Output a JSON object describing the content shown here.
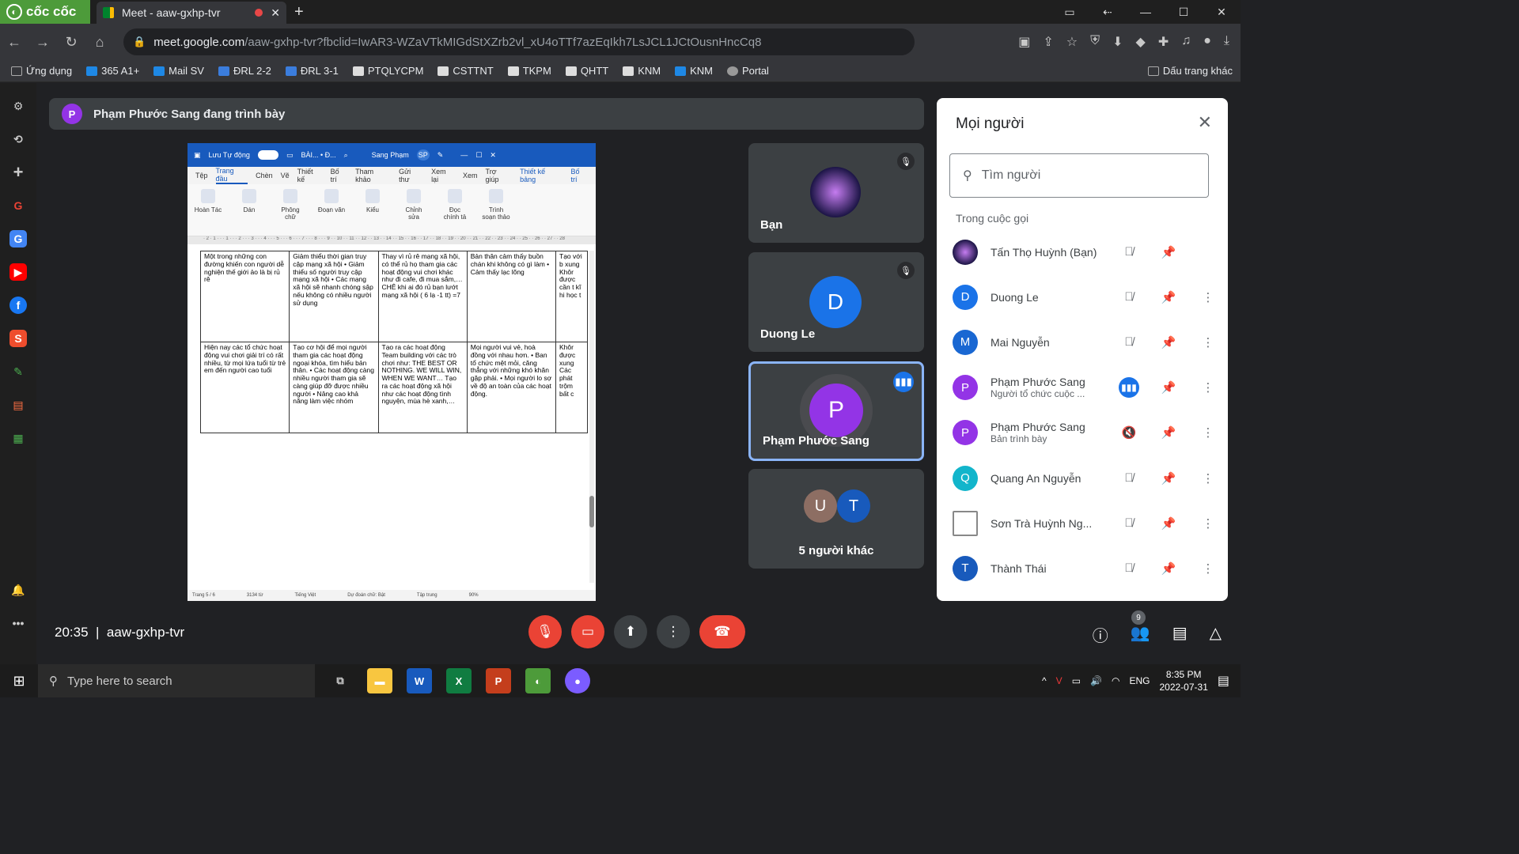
{
  "browser": {
    "brand": "cốc cốc",
    "tab_title": "Meet - aaw-gxhp-tvr",
    "url_host": "meet.google.com",
    "url_path": "/aaw-gxhp-tvr?fbclid=IwAR3-WZaVTkMIGdStXZrb2vl_xU4oTTf7azEqIkh7LsJCL1JCtOusnHncCq8"
  },
  "bookmarks": [
    "Ứng dụng",
    "365 A1+",
    "Mail SV",
    "ĐRL 2-2",
    "ĐRL 3-1",
    "PTQLYCPM",
    "CSTTNT",
    "TKPM",
    "QHTT",
    "KNM",
    "KNM",
    "Portal"
  ],
  "bookmarks_other": "Dấu trang khác",
  "presenting_banner": {
    "initial": "P",
    "text": "Phạm Phước Sang đang trình bày"
  },
  "word": {
    "autosave": "Lưu Tự động",
    "doc_title": "BÀI... • Đ...",
    "user": "Sang Phạm",
    "user_initials": "SP",
    "tabs": [
      "Tệp",
      "Trang đầu",
      "Chèn",
      "Vẽ",
      "Thiết kế",
      "Bố trí",
      "Tham khảo",
      "Gửi thư",
      "Xem lại",
      "Xem",
      "Trợ giúp",
      "Thiết kế bảng",
      "Bố trí"
    ],
    "ribbon": [
      "Hoàn Tác",
      "Dán",
      "Phông chữ",
      "Đoạn văn",
      "Kiểu",
      "Chỉnh sửa",
      "Đọc chính tả",
      "Trình soạn thảo"
    ],
    "ruler": "· 2 · 1 · · · 1 · · · 2 · · · 3 · · · 4 · · · 5 · · · 6 · · · 7 · · · 8 · · · 9 · · 10 · · 11 · · 12 · · 13 · · 14 · · 15 · · 16 · · 17 · · 18 · · 19 · · 20 · · 21 · · 22 · · 23 · · 24 · · 25 · · 26 · · 27 · · 28",
    "rows": [
      [
        "Một trong những con đường khiến con người dễ nghiện thế giới ảo là bị rủ rê",
        "Giảm thiểu thời gian truy cập mạng xã hội • Giảm thiểu số người truy cập mạng xã hội • Các mạng xã hội sẽ nhanh chóng sập nếu không có nhiều người sử dụng",
        "Thay vì rủ rê mạng xã hội, có thể rủ họ tham gia các hoạt động vui chơi khác như đi cafe, đi mua sắm,… CHÊ khi ai đó rủ bạn lướt mạng xã hội ( 6 lạ -1 tt) =7",
        "Bản thân cảm thấy buồn chán khi không có gì làm • Cảm thấy lạc lõng",
        "Tạo với b xung Khôr được cần t kĩ hi học t"
      ],
      [
        "Hiện nay các tổ chức hoạt động vui chơi giải trí có rất nhiều, từ mọi lứa tuổi từ trẻ em đến người cao tuổi",
        "Tạo cơ hội để mọi người tham gia các hoạt động ngoại khóa, tìm hiểu bản thân. • Các hoạt động càng nhiều người tham gia sẽ càng giúp đỡ được nhiều người • Nâng cao khả năng làm việc nhóm",
        "Tạo ra các hoạt động Team building với các trò chơi như: THE BEST OR NOTHING. WE WILL WIN, WHEN WE WANT… Tạo ra các hoạt động xã hội như các hoạt động tình nguyện, mùa hè xanh,…",
        "Mọi người vui vẻ, hoà đồng với nhau hơn. • Ban tổ chức mệt mỏi, căng thẳng với những khó khăn gặp phải. • Mọi người lo sợ về độ an toàn của các hoạt động.",
        "Khôr được xung Các phát trộm bất c"
      ]
    ],
    "status": [
      "Trang 5 / 6",
      "3134 từ",
      "Tiếng Việt",
      "Dự đoán chữ: Bật",
      "Tập trung",
      "90%"
    ]
  },
  "tiles": [
    {
      "name": "Bạn"
    },
    {
      "name": "Duong Le",
      "initial": "D"
    },
    {
      "name": "Phạm Phước Sang",
      "initial": "P"
    },
    {
      "name": "5 người khác",
      "initials": [
        "U",
        "T"
      ]
    }
  ],
  "people_panel": {
    "title": "Mọi người",
    "search_placeholder": "Tìm người",
    "section": "Trong cuộc gọi",
    "people": [
      {
        "name": "Tấn Thọ Huỳnh (Bạn)",
        "initial": "",
        "sub": "",
        "color": "#2a1e5c"
      },
      {
        "name": "Duong Le",
        "initial": "D",
        "sub": "",
        "color": "#1a73e8"
      },
      {
        "name": "Mai Nguyễn",
        "initial": "M",
        "sub": "",
        "color": "#1967d2"
      },
      {
        "name": "Phạm Phước Sang",
        "initial": "P",
        "sub": "Người tổ chức cuộc ...",
        "color": "#9334e6"
      },
      {
        "name": "Phạm Phước Sang",
        "initial": "P",
        "sub": "Bản trình bày",
        "color": "#9334e6"
      },
      {
        "name": "Quang An Nguyễn",
        "initial": "Q",
        "sub": "",
        "color": "#12b5cb"
      },
      {
        "name": "Sơn Trà Huỳnh Ng...",
        "initial": "",
        "sub": "",
        "color": "#ffffff"
      },
      {
        "name": "Thành Thái",
        "initial": "T",
        "sub": "",
        "color": "#185abc"
      }
    ]
  },
  "meeting": {
    "time": "20:35",
    "code": "aaw-gxhp-tvr",
    "people_count": "9"
  },
  "taskbar": {
    "search_placeholder": "Type here to search",
    "lang": "ENG",
    "time": "8:35 PM",
    "date": "2022-07-31"
  }
}
